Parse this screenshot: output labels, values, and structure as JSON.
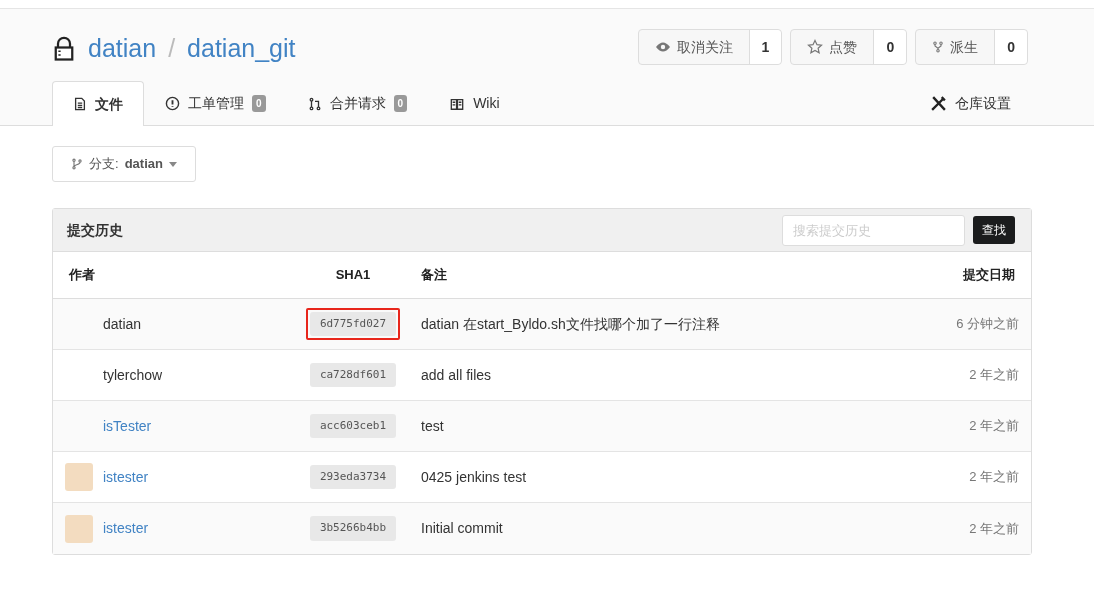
{
  "repo": {
    "owner": "datian",
    "separator": "/",
    "name": "datian_git",
    "private": true
  },
  "actions": [
    {
      "kind": "watch",
      "label": "取消关注",
      "count": "1"
    },
    {
      "kind": "star",
      "label": "点赞",
      "count": "0"
    },
    {
      "kind": "fork",
      "label": "派生",
      "count": "0"
    }
  ],
  "tabs": [
    {
      "kind": "files",
      "label": "文件",
      "selected": true
    },
    {
      "kind": "issues",
      "label": "工单管理",
      "badge": "0",
      "selected": false
    },
    {
      "kind": "pulls",
      "label": "合并请求",
      "badge": "0",
      "selected": false
    },
    {
      "kind": "wiki",
      "label": "Wiki",
      "selected": false
    }
  ],
  "settings_tab": {
    "label": "仓库设置",
    "selected": false
  },
  "branch": {
    "label": "分支:",
    "name": "datian"
  },
  "history": {
    "title": "提交历史",
    "search": {
      "placeholder": "搜索提交历史"
    },
    "button": "查找",
    "columns": [
      "作者",
      "SHA1",
      "备注",
      "提交日期"
    ],
    "rows": [
      {
        "author": "datian",
        "linked": false,
        "avatar": false,
        "sha": "6d775fd027",
        "highlighted": true,
        "message": "datian 在start_Byldo.sh文件找哪个加了一行注释",
        "date": "6 分钟之前"
      },
      {
        "author": "tylerchow",
        "linked": false,
        "avatar": false,
        "sha": "ca728df601",
        "highlighted": false,
        "message": "add all files",
        "date": "2 年之前"
      },
      {
        "author": "isTester",
        "linked": true,
        "avatar": false,
        "sha": "acc603ceb1",
        "highlighted": false,
        "message": "test",
        "date": "2 年之前"
      },
      {
        "author": "istester",
        "linked": true,
        "avatar": true,
        "sha": "293eda3734",
        "highlighted": false,
        "message": "0425 jenkins test",
        "date": "2 年之前"
      },
      {
        "author": "istester",
        "linked": true,
        "avatar": true,
        "sha": "3b5266b4bb",
        "highlighted": false,
        "message": "Initial commit",
        "date": "2 年之前"
      }
    ]
  }
}
